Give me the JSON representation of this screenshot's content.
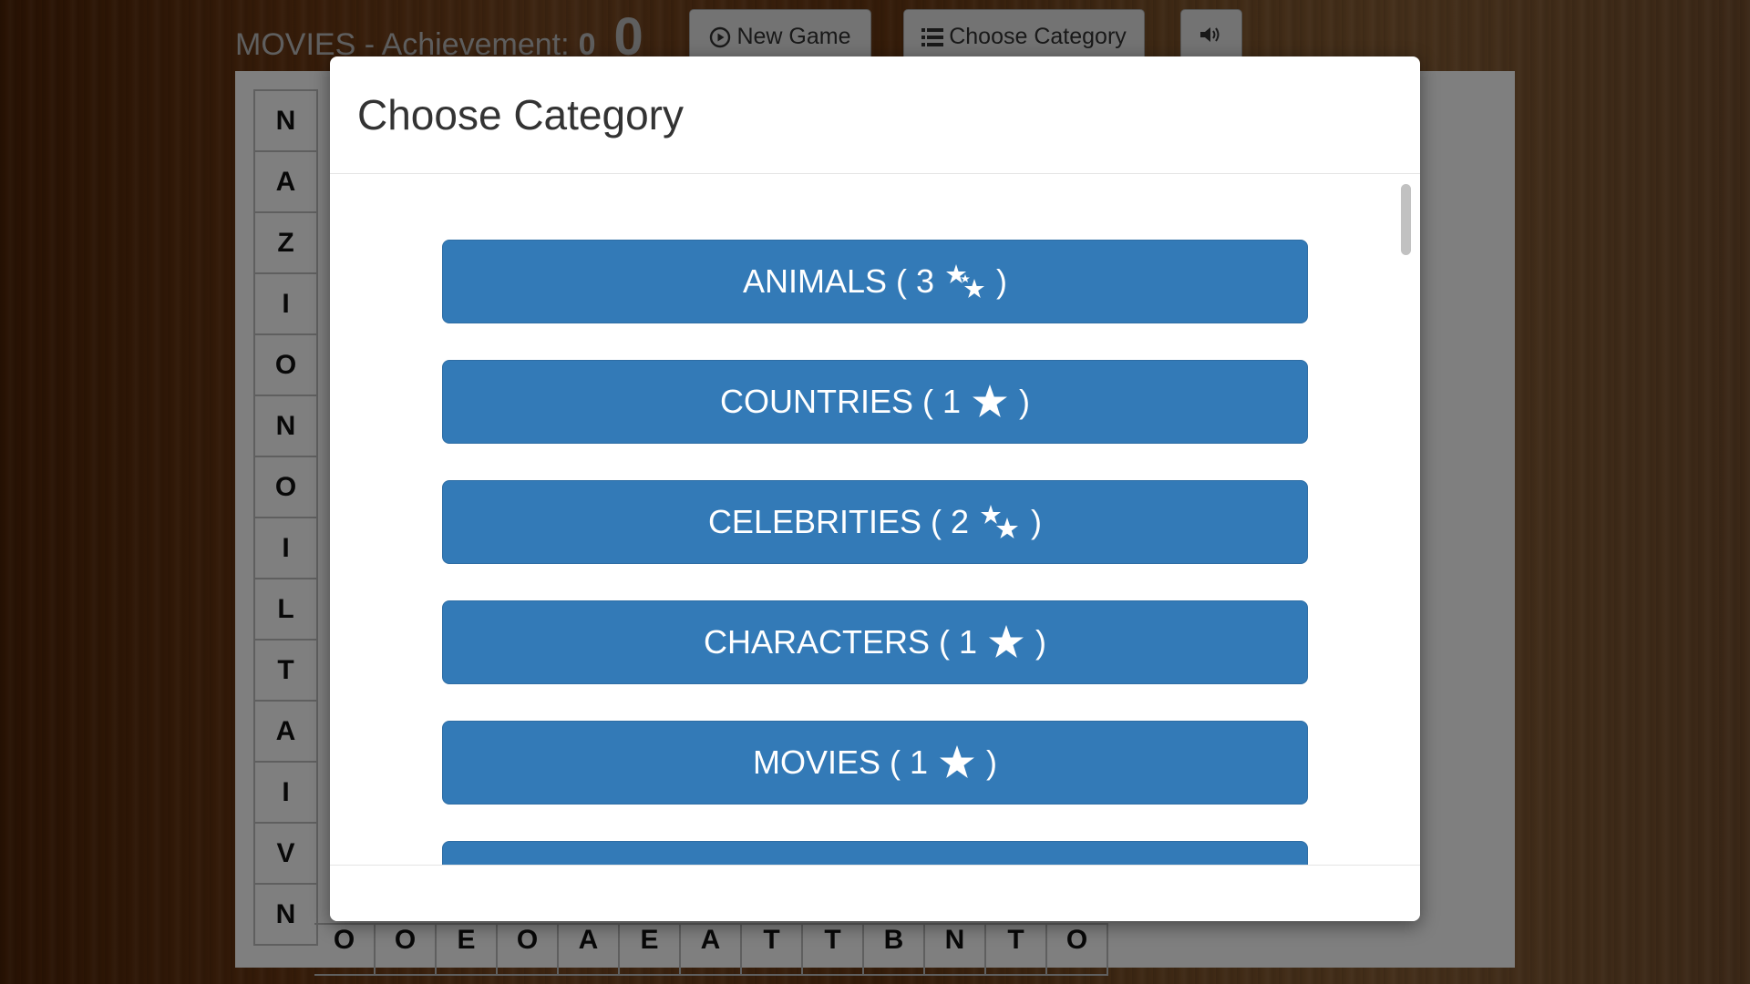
{
  "header": {
    "title_prefix": "MOVIES - Achievement:",
    "achievement_value": "0",
    "score": "0",
    "new_game_label": "New Game",
    "choose_category_label": "Choose Category",
    "sound_icon": "volume-icon"
  },
  "board": {
    "left_column": [
      "N",
      "A",
      "Z",
      "I",
      "O",
      "N",
      "O",
      "I",
      "L",
      "T",
      "A",
      "I",
      "V",
      "N"
    ],
    "bottom_row": [
      "O",
      "O",
      "E",
      "O",
      "A",
      "E",
      "A",
      "T",
      "T",
      "B",
      "N",
      "T",
      "O"
    ]
  },
  "modal": {
    "title": "Choose Category",
    "categories": [
      {
        "name": "ANIMALS",
        "count": "3",
        "star_icon": "stars-multi-icon"
      },
      {
        "name": "COUNTRIES",
        "count": "1",
        "star_icon": "star-icon"
      },
      {
        "name": "CELEBRITIES",
        "count": "2",
        "star_icon": "stars-multi-icon"
      },
      {
        "name": "CHARACTERS",
        "count": "1",
        "star_icon": "star-icon"
      },
      {
        "name": "MOVIES",
        "count": "1",
        "star_icon": "star-icon"
      }
    ]
  },
  "colors": {
    "button_primary": "#337ab7",
    "button_primary_border": "#2e6da4",
    "header_text": "#bfbfbf",
    "overlay": "rgba(0,0,0,0.5)"
  }
}
